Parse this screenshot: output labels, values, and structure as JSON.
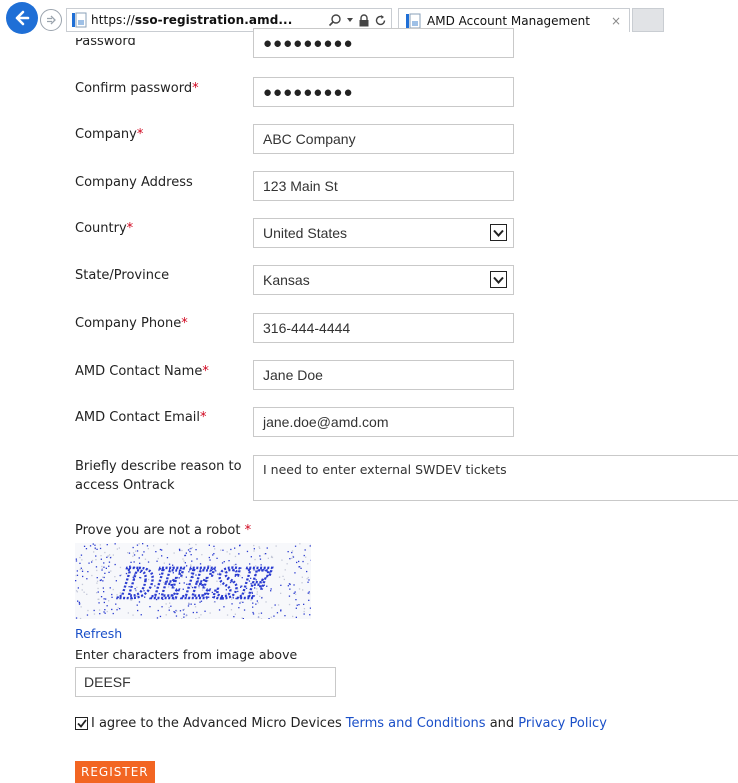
{
  "browser": {
    "url_scheme": "https://",
    "url_host": "sso-registration.amd...",
    "tab_title": "AMD Account Management",
    "tab_close": "×"
  },
  "form": {
    "password": {
      "label": "Password",
      "value": "●●●●●●●●●"
    },
    "confirm_password": {
      "label": "Confirm password",
      "required": "*",
      "value": "●●●●●●●●●"
    },
    "company": {
      "label": "Company",
      "required": "*",
      "value": "ABC Company"
    },
    "company_address": {
      "label": "Company Address",
      "value": "123 Main St"
    },
    "country": {
      "label": "Country",
      "required": "*",
      "value": "United States"
    },
    "state": {
      "label": "State/Province",
      "value": "Kansas"
    },
    "company_phone": {
      "label": "Company Phone",
      "required": "*",
      "value": "316-444-4444"
    },
    "contact_name": {
      "label": "AMD Contact Name",
      "required": "*",
      "value": "Jane Doe"
    },
    "contact_email": {
      "label": "AMD Contact Email",
      "required": "*",
      "value": "jane.doe@amd.com"
    },
    "reason": {
      "label_line1": "Briefly describe reason to",
      "label_line2": "access Ontrack",
      "value": "I need to enter external SWDEV tickets"
    },
    "robot": {
      "label": "Prove you are not a robot ",
      "required": "*",
      "captcha_text": "DEESF"
    },
    "refresh": "Refresh",
    "captcha_prompt": "Enter characters from image above",
    "captcha_value": "DEESF",
    "agree": {
      "prefix": "I agree to the Advanced Micro Devices ",
      "terms": "Terms and Conditions",
      "middle": " and ",
      "privacy": "Privacy Policy",
      "checked": true
    },
    "register": "REGISTER"
  },
  "colors": {
    "accent": "#f26522",
    "link": "#1a4fc8",
    "required": "#d0021b",
    "back_button": "#1f6fd6"
  }
}
